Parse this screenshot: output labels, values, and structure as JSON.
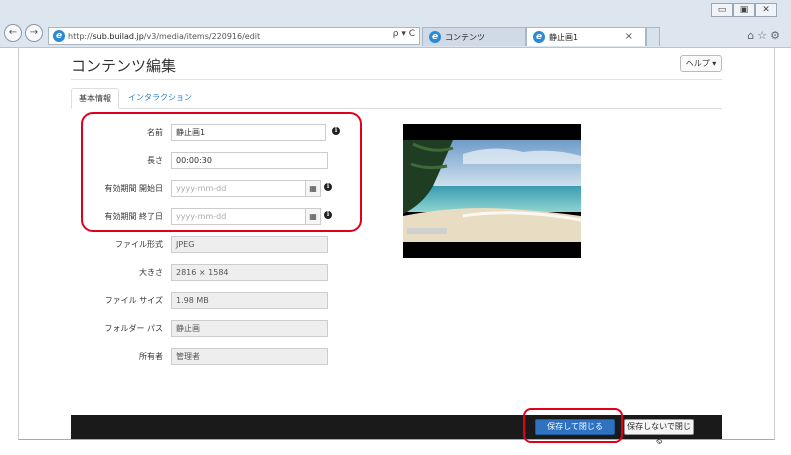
{
  "browser": {
    "url_prefix": "http://",
    "url_host": "sub.builad.jp",
    "url_path": "/v3/media/items/220916/edit",
    "addr_tools": "ρ ▾ C",
    "tabs": [
      {
        "label": "コンテンツ"
      },
      {
        "label": "静止画1"
      }
    ],
    "tab_close": "×",
    "window_controls": [
      "▭",
      "▣",
      "✕"
    ],
    "right_icons": "⌂☆⚙"
  },
  "page": {
    "title": "コンテンツ編集",
    "help_button": "ヘルプ ▾",
    "tabs": [
      {
        "label": "基本情報"
      },
      {
        "label": "インタラクション"
      }
    ]
  },
  "form": {
    "name": {
      "label": "名前",
      "value": "静止画1"
    },
    "length": {
      "label": "長さ",
      "value": "00:00:30"
    },
    "valid_start": {
      "label": "有効期間 開始日",
      "placeholder": "yyyy-mm-dd"
    },
    "valid_end": {
      "label": "有効期間 終了日",
      "placeholder": "yyyy-mm-dd"
    },
    "file_format": {
      "label": "ファイル形式",
      "value": "JPEG"
    },
    "size": {
      "label": "大きさ",
      "value": "2816 × 1584"
    },
    "file_size": {
      "label": "ファイル サイズ",
      "value": "1.98 MB"
    },
    "folder_path": {
      "label": "フォルダー パス",
      "value": "静止画"
    },
    "owner": {
      "label": "所有者",
      "value": "管理者"
    }
  },
  "footer": {
    "save_close": "保存して閉じる",
    "close_without_save": "保存しないで閉じる"
  },
  "icons": {
    "calendar": "▦",
    "info": "i"
  },
  "colors": {
    "highlight": "#e0001b",
    "primary_button": "#2f73c0",
    "link": "#2a7ec2"
  }
}
